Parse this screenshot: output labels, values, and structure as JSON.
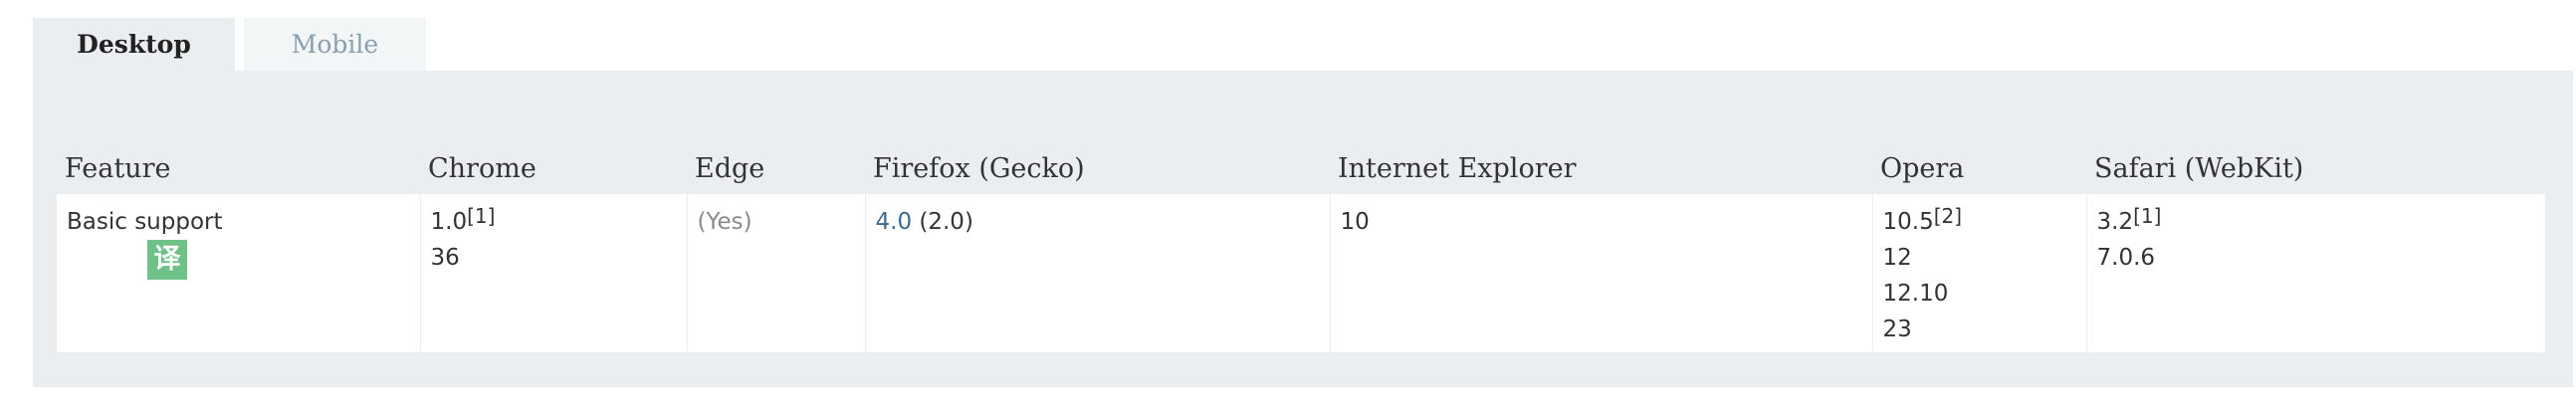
{
  "tabs": [
    {
      "label": "Desktop",
      "active": true
    },
    {
      "label": "Mobile",
      "active": false
    }
  ],
  "table": {
    "headers": [
      "Feature",
      "Chrome",
      "Edge",
      "Firefox (Gecko)",
      "Internet Explorer",
      "Opera",
      "Safari (WebKit)"
    ],
    "row": {
      "feature": "Basic support",
      "translate_badge": "译",
      "chrome": [
        {
          "text": "1.0",
          "note": "[1]"
        },
        {
          "text": "36"
        }
      ],
      "edge": "(Yes)",
      "firefox": {
        "link": "4.0",
        "rest": " (2.0)"
      },
      "ie": "10",
      "opera": [
        {
          "text": "10.5",
          "note": "[2]"
        },
        {
          "text": "12"
        },
        {
          "text": "12.10"
        },
        {
          "text": "23"
        }
      ],
      "safari": [
        {
          "text": "3.2",
          "note": "[1]"
        },
        {
          "text": "7.0.6"
        }
      ]
    }
  },
  "colors": {
    "panel_bg": "#eaeef1",
    "link": "#3c6b8f",
    "badge": "#6fc287",
    "inactive_tab_text": "#8a9fae"
  }
}
